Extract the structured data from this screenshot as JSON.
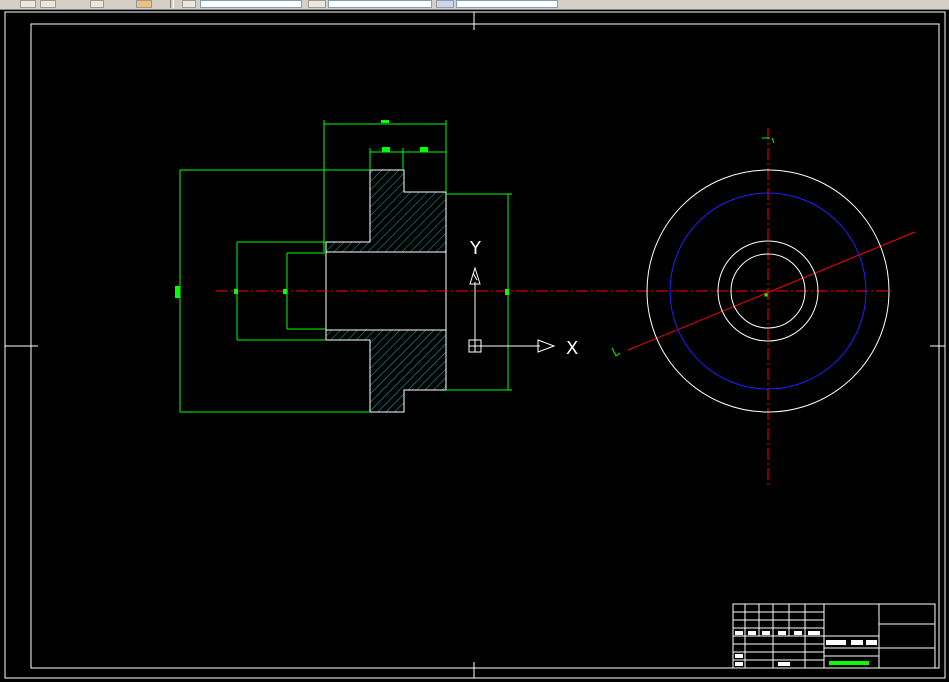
{
  "colors": {
    "background": "#000000",
    "frame": "#ffffff",
    "dimension": "#00ff00",
    "centerline": "#ff0000",
    "hatch": "#00b4b4",
    "circle_blue": "#2020ff",
    "toolbar": "#d4d0c8"
  },
  "toolbar": {
    "icons": [
      "toolbar-button",
      "toolbar-button",
      "toolbar-button",
      "toolbar-button",
      "toolbar-button",
      "toolbar-button"
    ]
  },
  "ucs": {
    "x_label": "X",
    "y_label": "Y"
  }
}
